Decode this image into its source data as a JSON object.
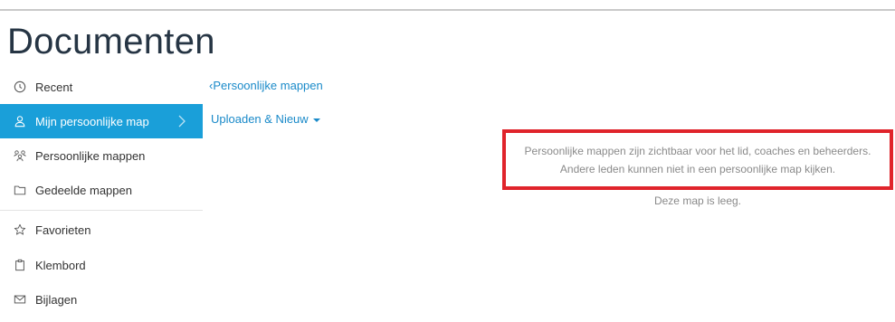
{
  "page": {
    "title": "Documenten"
  },
  "sidebar": {
    "items": [
      {
        "label": "Recent",
        "icon": "clock-icon"
      },
      {
        "label": "Mijn persoonlijke map",
        "icon": "user-icon",
        "active": true
      },
      {
        "label": "Persoonlijke mappen",
        "icon": "users-icon"
      },
      {
        "label": "Gedeelde mappen",
        "icon": "folder-icon"
      },
      {
        "label": "Favorieten",
        "icon": "star-icon"
      },
      {
        "label": "Klembord",
        "icon": "clipboard-icon"
      },
      {
        "label": "Bijlagen",
        "icon": "mail-icon"
      }
    ]
  },
  "main": {
    "back_link": "Persoonlijke mappen",
    "upload_menu": "Uploaden & Nieuw",
    "notice_line1": "Persoonlijke mappen zijn zichtbaar voor het lid, coaches en beheerders.",
    "notice_line2": "Andere leden kunnen niet in een persoonlijke map kijken.",
    "empty_text": "Deze map is leeg."
  },
  "colors": {
    "accent": "#1a9fd9",
    "link": "#1a8ac9",
    "highlight_border": "#e0242b",
    "title": "#263544"
  }
}
